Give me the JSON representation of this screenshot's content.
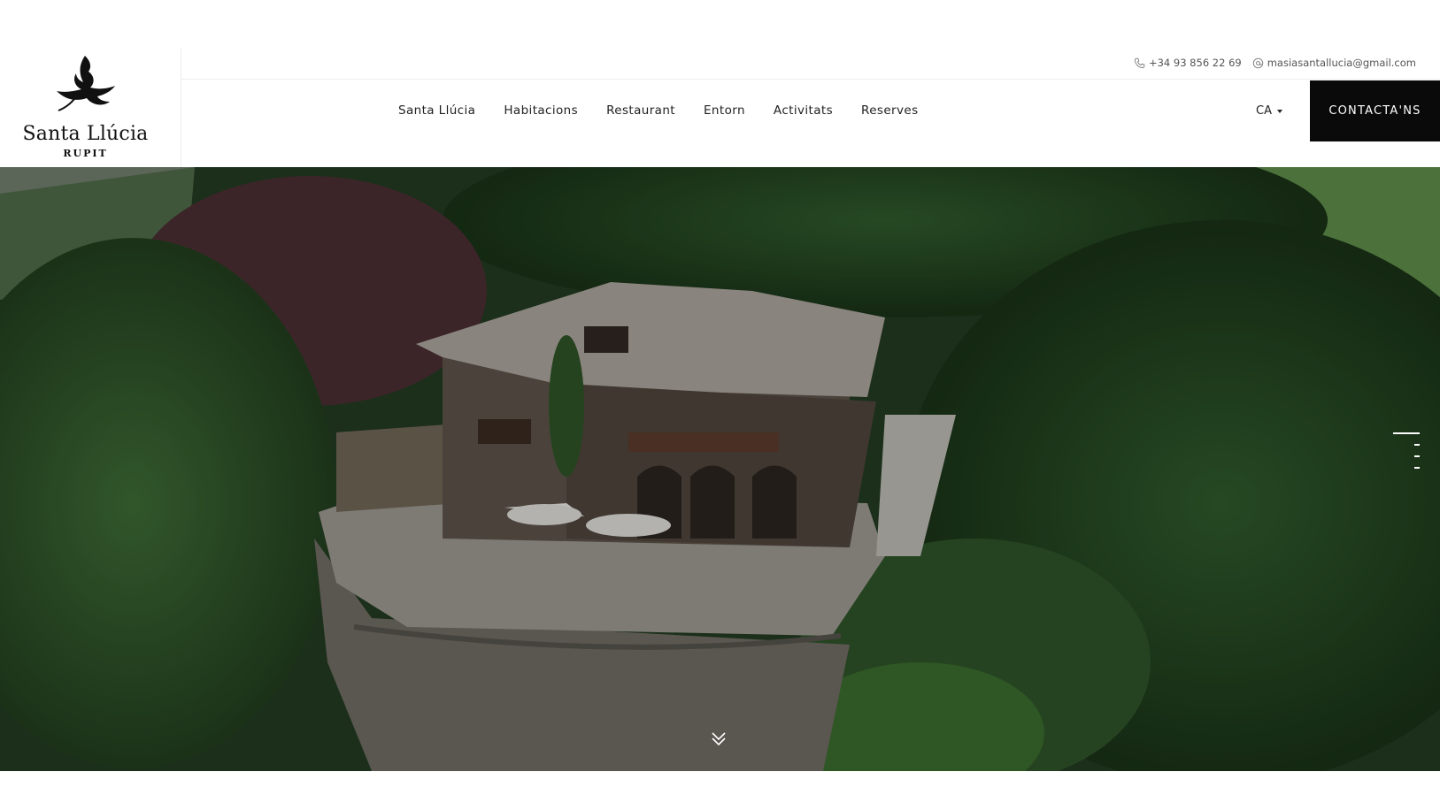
{
  "logo": {
    "name": "Santa Llúcia",
    "sub": "RUPIT",
    "icon": "flame-dove-logo-icon"
  },
  "contact": {
    "phone": "+34 93 856 22 69",
    "email": "masiasantallucia@gmail.com",
    "phone_icon": "phone-icon",
    "email_icon": "at-icon"
  },
  "nav": {
    "items": [
      {
        "label": "Santa Llúcia"
      },
      {
        "label": "Habitacions"
      },
      {
        "label": "Restaurant"
      },
      {
        "label": "Entorn"
      },
      {
        "label": "Activitats"
      },
      {
        "label": "Reserves"
      }
    ],
    "language": "CA",
    "cta_label": "CONTACTA'NS"
  },
  "hero": {
    "image_subject": "aerial-view-of-stone-farmhouse",
    "slides_count": 4,
    "active_slide": 1,
    "scroll_icon": "double-chevron-down-icon"
  },
  "colors": {
    "cta_bg": "#0a0a0a",
    "text": "#222222",
    "divider": "#ececec"
  }
}
